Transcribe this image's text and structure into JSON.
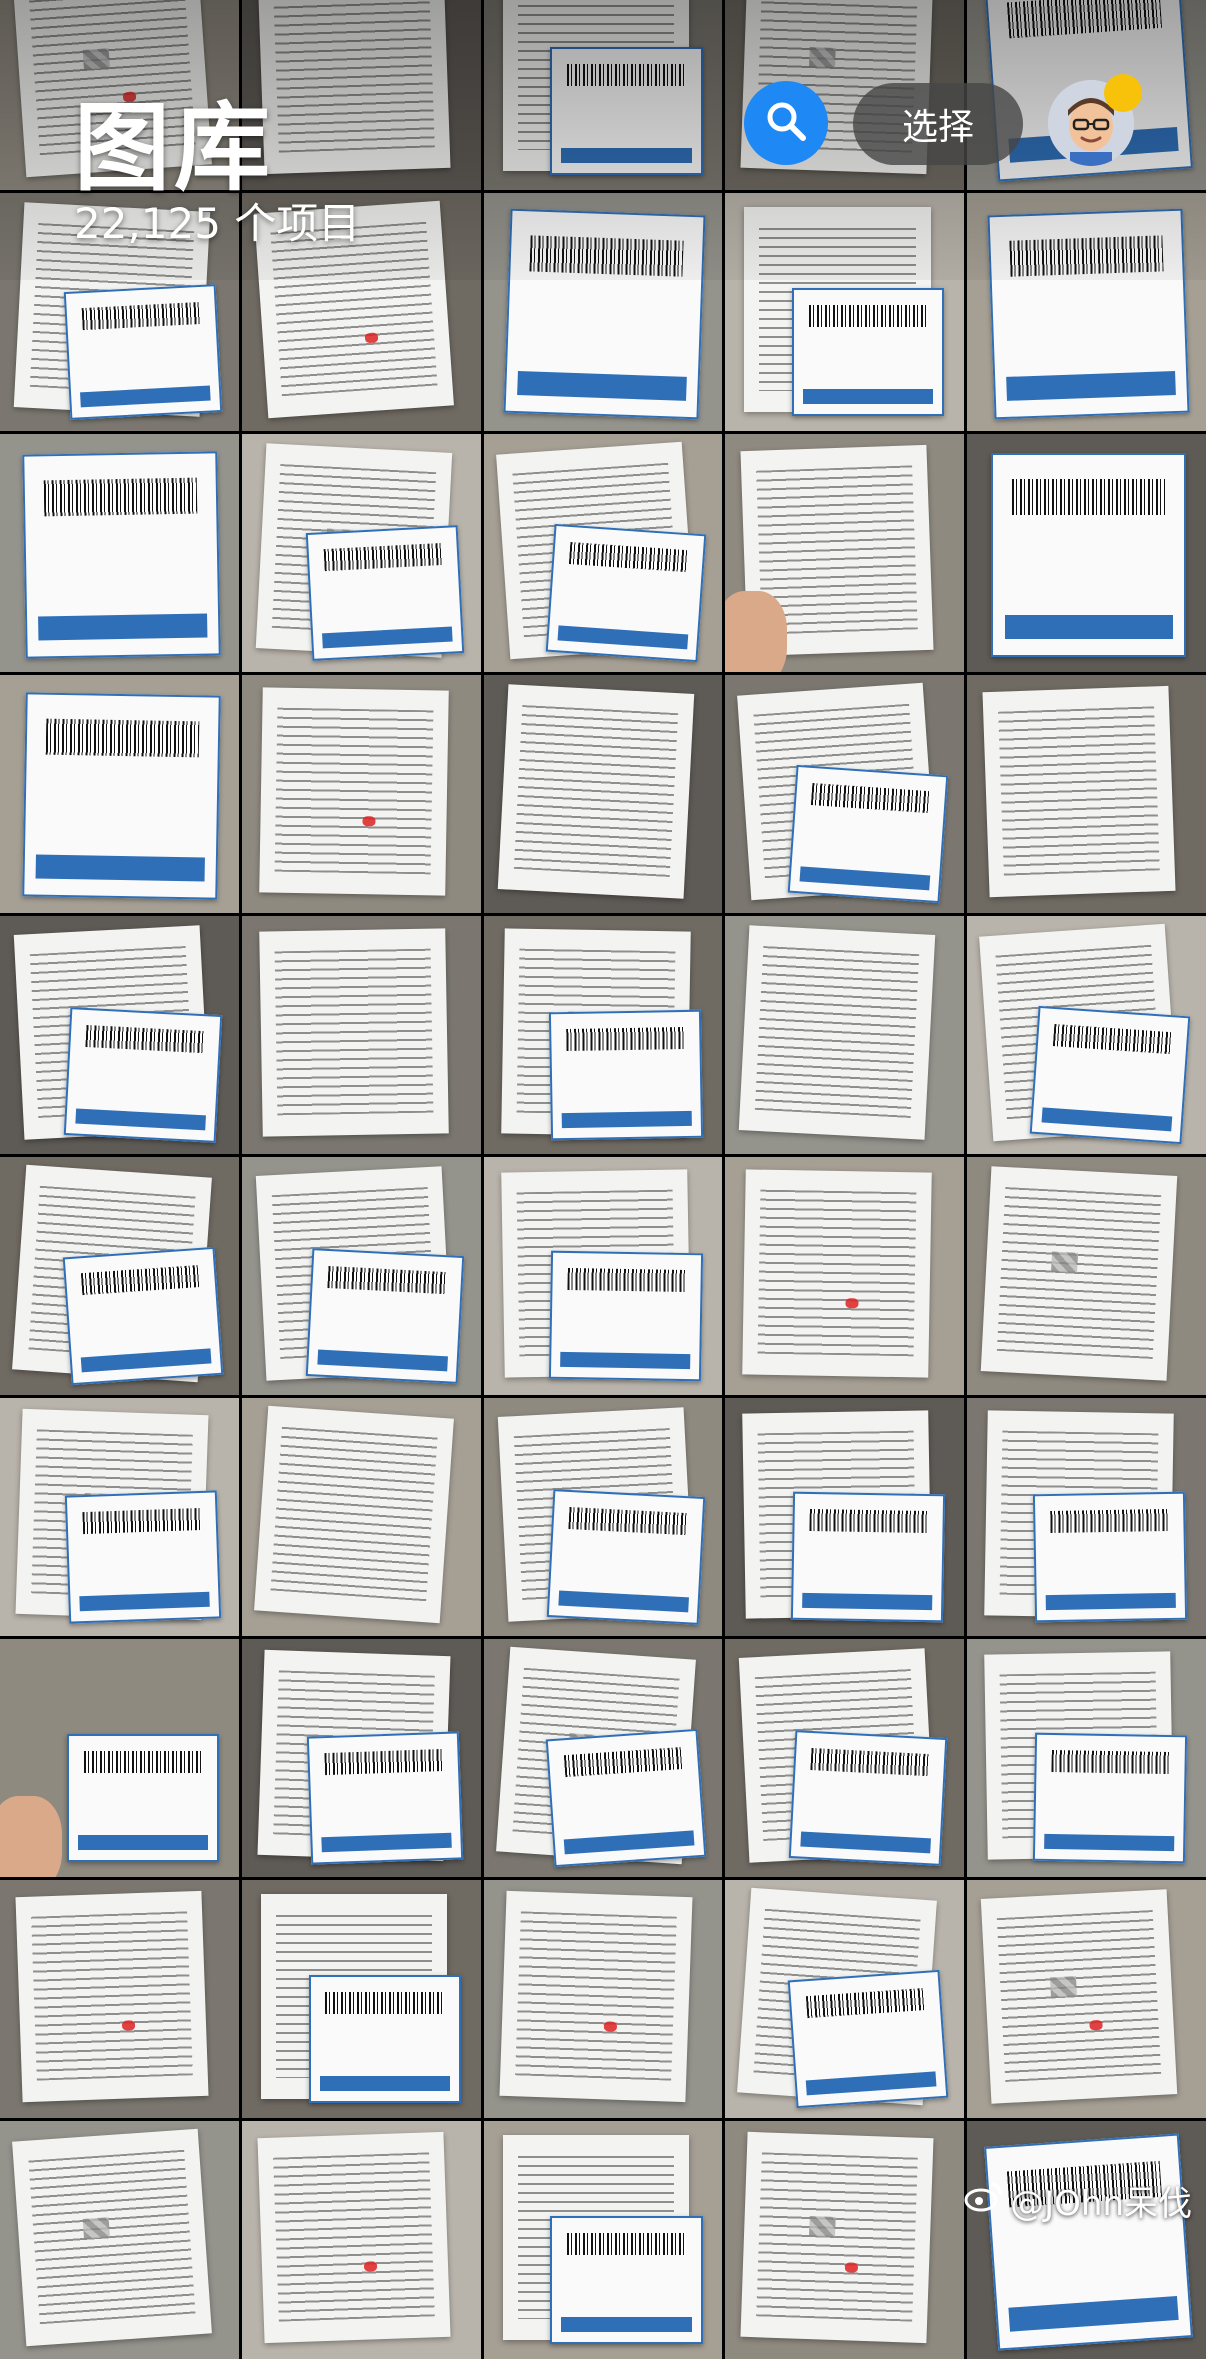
{
  "header": {
    "title": "图库",
    "item_count": "22,125 个项目",
    "select_label": "选择"
  },
  "icons": {
    "search": "search-icon",
    "avatar": "memoji-avatar",
    "notification": "notification-dot"
  },
  "colors": {
    "search_button": "#1e88f5",
    "notification_dot": "#f8c20a",
    "label_blue": "#2f6fb8",
    "stamp_red": "#d22222"
  },
  "grid": {
    "columns": 5,
    "rows": 10
  },
  "photos": [
    {
      "kind": "desk"
    },
    {
      "kind": "doc"
    },
    {
      "kind": "label-doc"
    },
    {
      "kind": "doc"
    },
    {
      "kind": "label"
    },
    {
      "kind": "doc-label"
    },
    {
      "kind": "stamp-doc"
    },
    {
      "kind": "ems-label"
    },
    {
      "kind": "label-doc"
    },
    {
      "kind": "label"
    },
    {
      "kind": "label"
    },
    {
      "kind": "doc-label"
    },
    {
      "kind": "label-doc"
    },
    {
      "kind": "hand-doc"
    },
    {
      "kind": "ems-label"
    },
    {
      "kind": "label"
    },
    {
      "kind": "doc"
    },
    {
      "kind": "doc"
    },
    {
      "kind": "label-doc"
    },
    {
      "kind": "doc"
    },
    {
      "kind": "doc-label"
    },
    {
      "kind": "doc"
    },
    {
      "kind": "doc-label"
    },
    {
      "kind": "doc"
    },
    {
      "kind": "label-doc"
    },
    {
      "kind": "label-doc"
    },
    {
      "kind": "doc-label"
    },
    {
      "kind": "label-doc"
    },
    {
      "kind": "doc"
    },
    {
      "kind": "doc"
    },
    {
      "kind": "doc-label"
    },
    {
      "kind": "doc"
    },
    {
      "kind": "doc-label"
    },
    {
      "kind": "doc-label"
    },
    {
      "kind": "label-doc"
    },
    {
      "kind": "hand-label"
    },
    {
      "kind": "label-doc"
    },
    {
      "kind": "label-doc"
    },
    {
      "kind": "doc-label"
    },
    {
      "kind": "doc-label"
    },
    {
      "kind": "doc"
    },
    {
      "kind": "label-doc"
    },
    {
      "kind": "doc"
    },
    {
      "kind": "label-doc"
    },
    {
      "kind": "doc"
    }
  ],
  "watermark": {
    "text": "@JOhn呆伐"
  }
}
